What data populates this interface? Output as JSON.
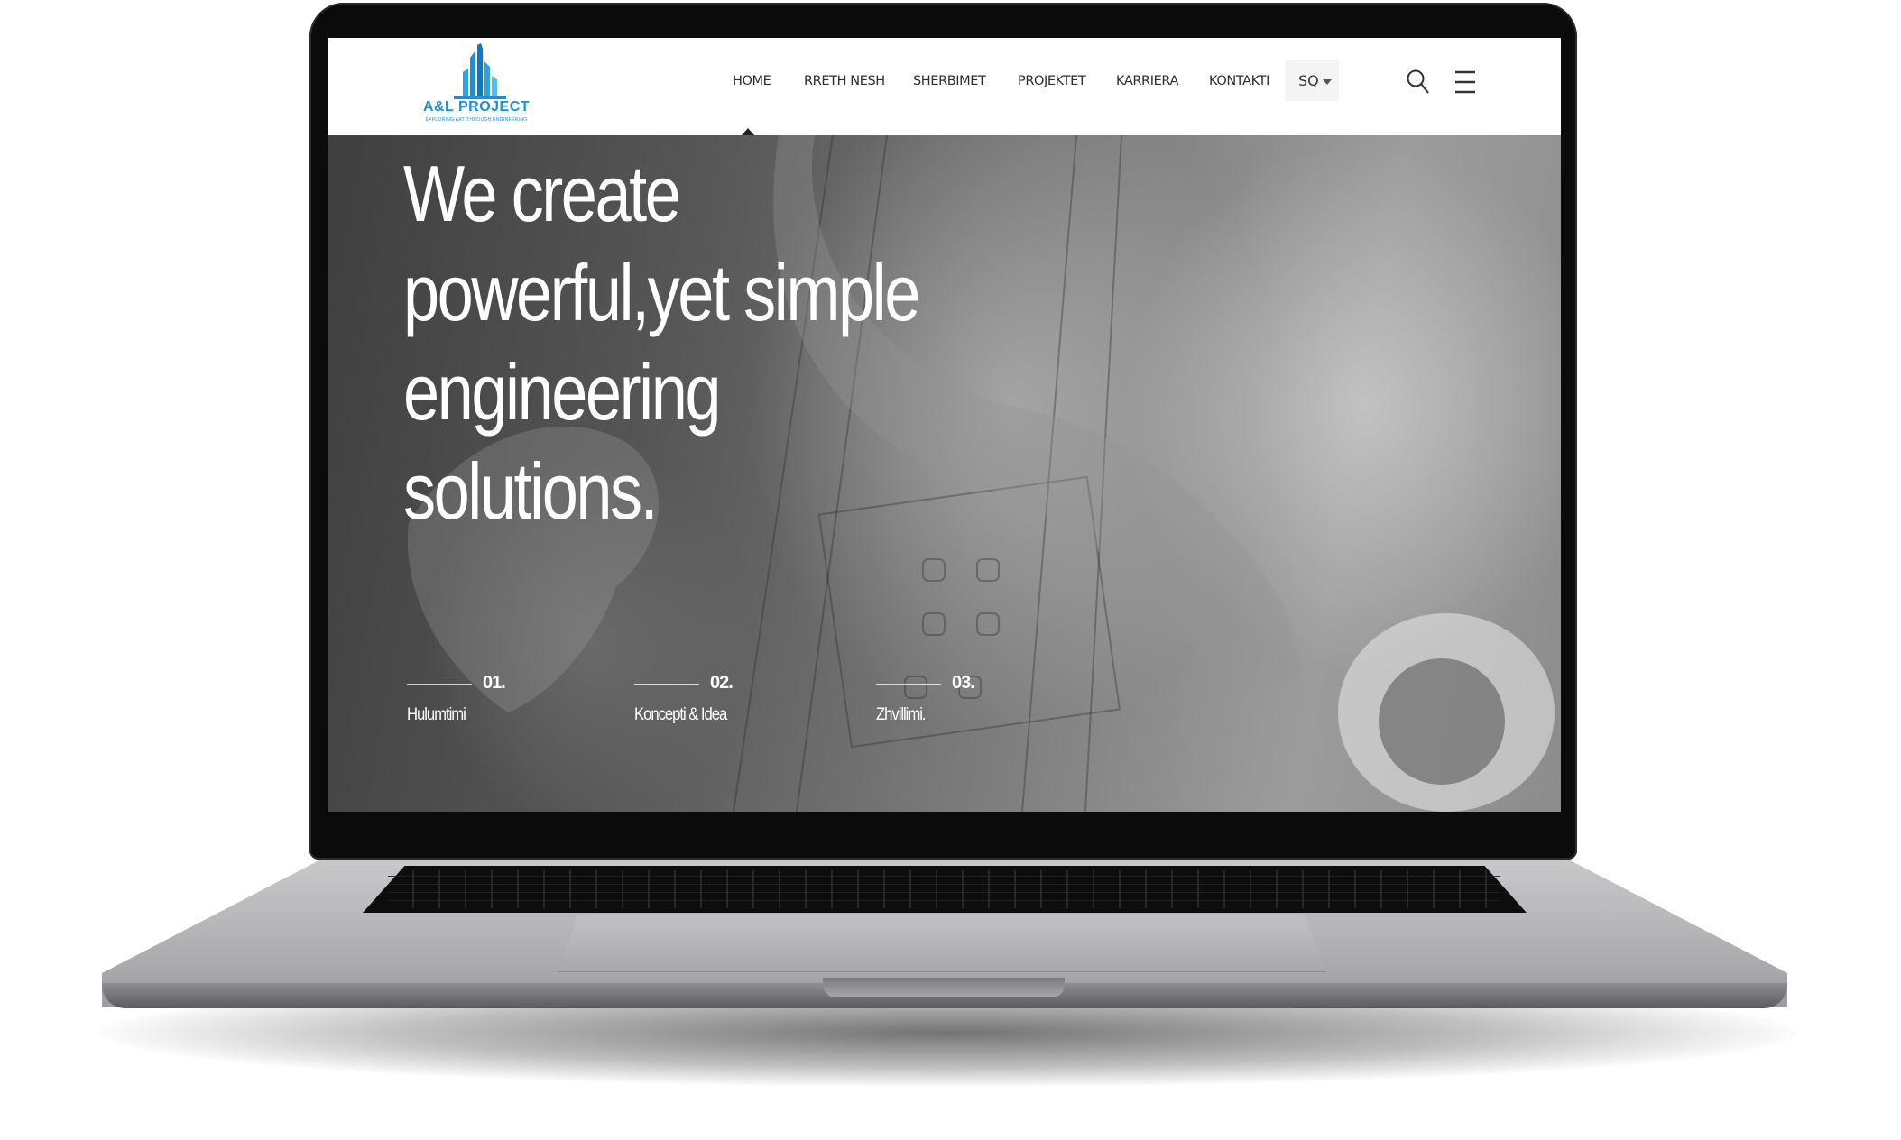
{
  "site": {
    "logo": {
      "name": "A&L PROJECT",
      "tagline": "EXPLORING ART THROUGH ENGINEERING"
    },
    "nav": {
      "items": [
        {
          "label": "HOME",
          "active": true
        },
        {
          "label": "RRETH NESH"
        },
        {
          "label": "SHERBIMET"
        },
        {
          "label": "PROJEKTET"
        },
        {
          "label": "KARRIERA"
        },
        {
          "label": "KONTAKTI"
        }
      ],
      "language": "SQ"
    },
    "icons": {
      "search": "search-icon",
      "menu": "hamburger-menu-icon"
    },
    "hero": {
      "headline_lines": [
        "We create",
        "powerful,yet simple",
        "engineering solutions."
      ],
      "steps": [
        {
          "number": "01.",
          "label": "Hulumtimi"
        },
        {
          "number": "02.",
          "label": "Koncepti & Idea"
        },
        {
          "number": "03.",
          "label": "Zhvillimi."
        }
      ]
    },
    "colors": {
      "brand": "#1b8fd8",
      "nav_text": "#2d2d2d",
      "hero_text": "#ffffff"
    }
  }
}
